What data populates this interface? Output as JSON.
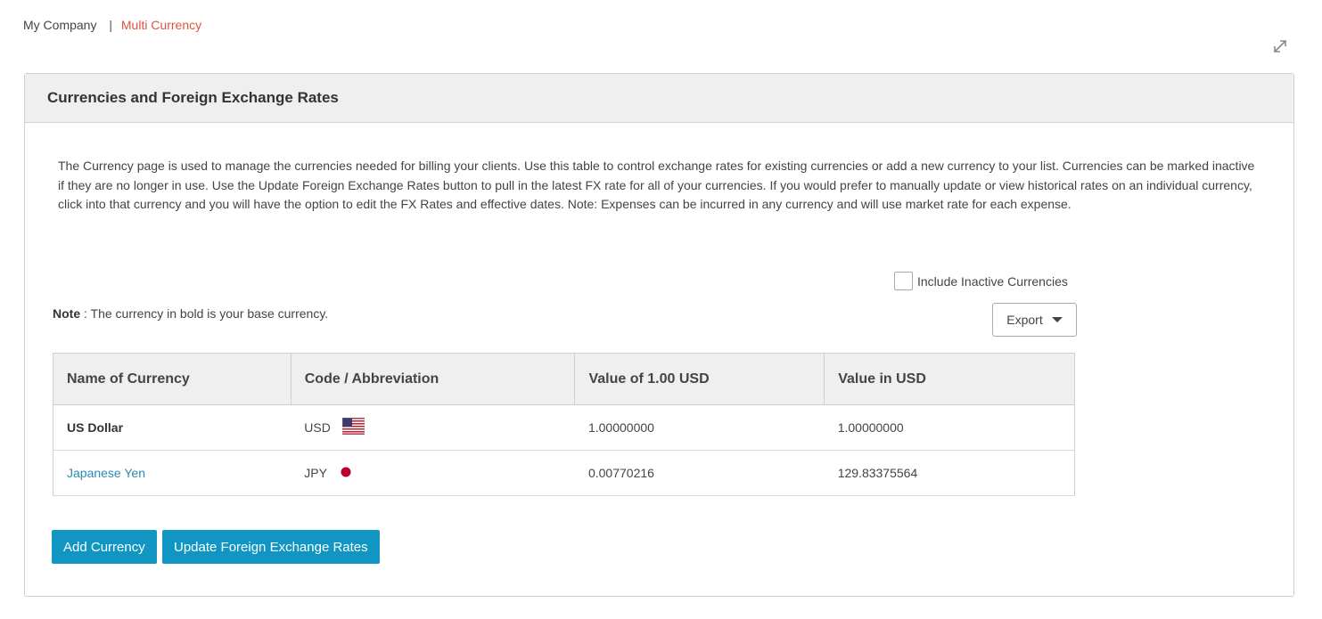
{
  "breadcrumb": {
    "parent": "My Company",
    "separator": "|",
    "current": "Multi Currency"
  },
  "icons": {
    "expand": "expand-arrows-icon"
  },
  "panel": {
    "title": "Currencies and Foreign Exchange Rates",
    "description": "The Currency page is used to manage the currencies needed for billing your clients. Use this table to control exchange rates for existing currencies or add a new currency to your list. Currencies can be marked inactive if they are no longer in use. Use the Update Foreign Exchange Rates button to pull in the latest FX rate for all of your currencies. If you would prefer to manually update or view historical rates on an individual currency, click into that currency and you will have the option to edit the FX Rates and effective dates. Note: Expenses can be incurred in any currency and will use market rate for each expense."
  },
  "filters": {
    "include_inactive_label": "Include Inactive Currencies",
    "include_inactive_checked": false
  },
  "note": {
    "label": "Note",
    "text": " : The currency in bold is your base currency."
  },
  "export": {
    "label": "Export"
  },
  "table": {
    "headers": [
      "Name of Currency",
      "Code / Abbreviation",
      "Value of 1.00 USD",
      "Value in USD"
    ],
    "rows": [
      {
        "name": "US Dollar",
        "code": "USD",
        "flag": "us-flag-icon",
        "value_of_usd": "1.00000000",
        "value_in_usd": "1.00000000",
        "is_base": true
      },
      {
        "name": "Japanese Yen",
        "code": "JPY",
        "flag": "japan-flag-icon",
        "value_of_usd": "0.00770216",
        "value_in_usd": "129.83375564",
        "is_base": false
      }
    ]
  },
  "actions": {
    "add_currency": "Add Currency",
    "update_fx": "Update Foreign Exchange Rates"
  },
  "colors": {
    "accent": "#1196c4",
    "breadcrumb_current": "#e0533d",
    "link": "#2a8ab8"
  }
}
